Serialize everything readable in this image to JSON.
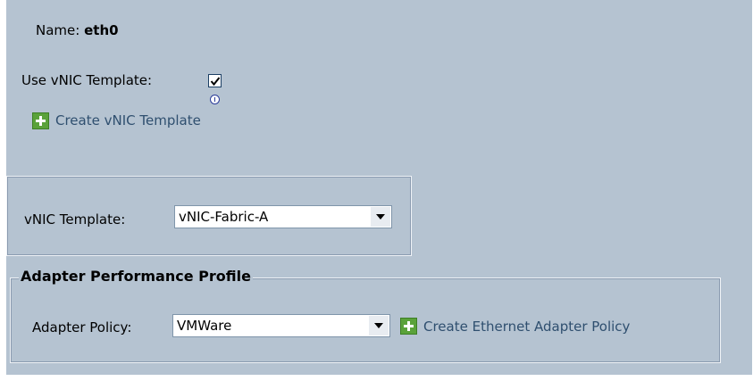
{
  "name": {
    "label": "Name:",
    "value": "eth0"
  },
  "use_template": {
    "label": "Use vNIC Template:",
    "checked": true
  },
  "create_template_link": {
    "label": "Create vNIC Template",
    "icon": "plus-icon"
  },
  "template_group": {
    "label": "vNIC Template:",
    "selected": "vNIC-Fabric-A"
  },
  "adapter_profile": {
    "title": "Adapter Performance Profile",
    "policy_label": "Adapter Policy:",
    "policy_selected": "VMWare",
    "create_policy_label": "Create Ethernet Adapter Policy",
    "create_policy_icon": "plus-icon"
  },
  "colors": {
    "panel_bg": "#b5c3d1",
    "plus_icon": "#5aa23a",
    "link_text": "#2f4f6f"
  }
}
